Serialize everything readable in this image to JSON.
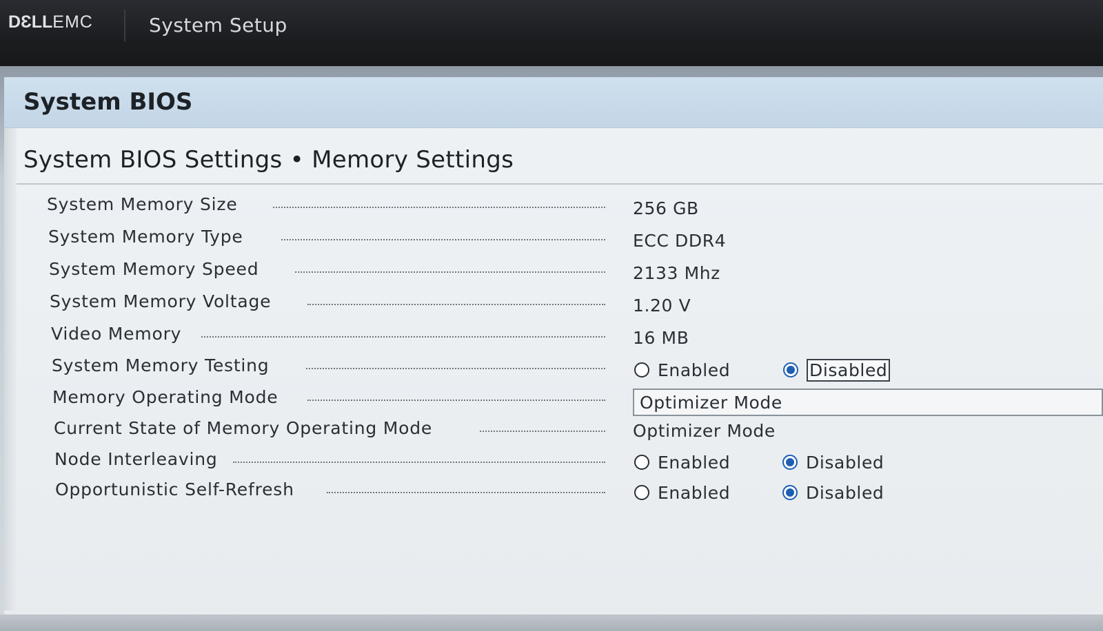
{
  "header": {
    "brand_strong": "DƐLL",
    "brand_light": "EMC",
    "app_title": "System Setup"
  },
  "section": {
    "title": "System BIOS",
    "page_title": "System BIOS Settings • Memory Settings"
  },
  "settings": [
    {
      "label": "System Memory Size",
      "value": "256 GB"
    },
    {
      "label": "System Memory Type",
      "value": "ECC DDR4"
    },
    {
      "label": "System Memory Speed",
      "value": "2133 Mhz"
    },
    {
      "label": "System Memory Voltage",
      "value": "1.20 V"
    },
    {
      "label": "Video Memory",
      "value": "16 MB"
    },
    {
      "label": "System Memory Testing",
      "options": [
        "Enabled",
        "Disabled"
      ],
      "selected": "Disabled"
    },
    {
      "label": "Memory Operating Mode",
      "value": "Optimizer Mode"
    },
    {
      "label": "Current State of Memory Operating Mode",
      "value": "Optimizer Mode"
    },
    {
      "label": "Node Interleaving",
      "options": [
        "Enabled",
        "Disabled"
      ],
      "selected": "Disabled"
    },
    {
      "label": "Opportunistic Self-Refresh",
      "options": [
        "Enabled",
        "Disabled"
      ],
      "selected": "Disabled"
    }
  ],
  "colors": {
    "accent": "#1d5fb3",
    "header_band": "#c3d6e6",
    "topbar": "#1c1d20"
  }
}
